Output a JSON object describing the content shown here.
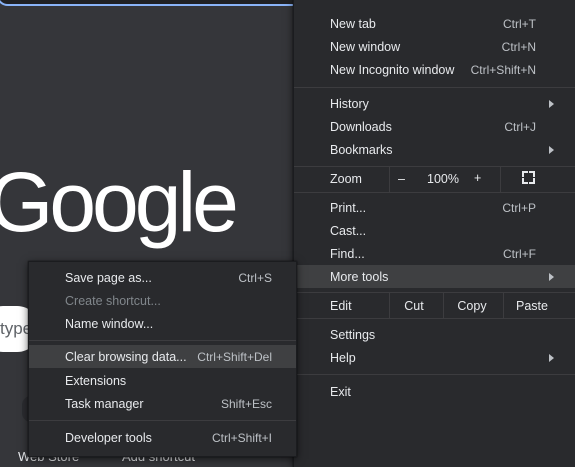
{
  "background": {
    "logo_text": "Google",
    "search_placeholder": "type",
    "bottom_links": [
      "Web Store",
      "Add shortcut"
    ]
  },
  "main_menu": {
    "new_tab": {
      "label": "New tab",
      "shortcut": "Ctrl+T"
    },
    "new_window": {
      "label": "New window",
      "shortcut": "Ctrl+N"
    },
    "new_incognito": {
      "label": "New Incognito window",
      "shortcut": "Ctrl+Shift+N"
    },
    "history": {
      "label": "History"
    },
    "downloads": {
      "label": "Downloads",
      "shortcut": "Ctrl+J"
    },
    "bookmarks": {
      "label": "Bookmarks"
    },
    "zoom": {
      "label": "Zoom",
      "minus": "–",
      "value": "100%",
      "plus": "+"
    },
    "print": {
      "label": "Print...",
      "shortcut": "Ctrl+P"
    },
    "cast": {
      "label": "Cast..."
    },
    "find": {
      "label": "Find...",
      "shortcut": "Ctrl+F"
    },
    "more_tools": {
      "label": "More tools"
    },
    "edit": {
      "label": "Edit",
      "cut": "Cut",
      "copy": "Copy",
      "paste": "Paste"
    },
    "settings": {
      "label": "Settings"
    },
    "help": {
      "label": "Help"
    },
    "exit": {
      "label": "Exit"
    }
  },
  "sub_menu": {
    "save_page": {
      "label": "Save page as...",
      "shortcut": "Ctrl+S"
    },
    "create_shortcut": {
      "label": "Create shortcut..."
    },
    "name_window": {
      "label": "Name window..."
    },
    "clear_browsing": {
      "label": "Clear browsing data...",
      "shortcut": "Ctrl+Shift+Del"
    },
    "extensions": {
      "label": "Extensions"
    },
    "task_manager": {
      "label": "Task manager",
      "shortcut": "Shift+Esc"
    },
    "developer_tools": {
      "label": "Developer tools",
      "shortcut": "Ctrl+Shift+I"
    }
  },
  "colors": {
    "menu_bg": "#292a2d",
    "hover_bg": "#3f4042",
    "page_bg": "#35363a",
    "omnibox_border": "#8ab4f8"
  }
}
